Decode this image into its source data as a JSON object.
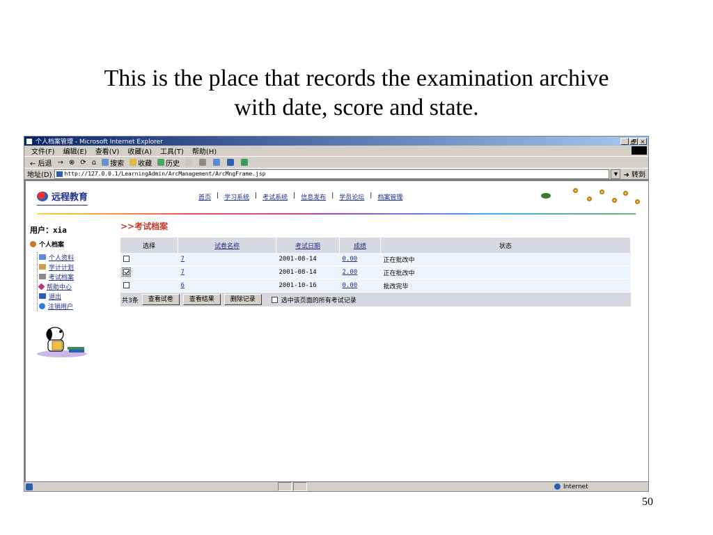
{
  "slide": {
    "title_line1": "This is the place that records the examination archive",
    "title_line2": "with date, score and state.",
    "page_number": "50"
  },
  "window": {
    "title": "个人档案管理 - Microsoft Internet Explorer",
    "controls": [
      "_",
      "🗗",
      "×"
    ]
  },
  "menu": [
    "文件(F)",
    "编辑(E)",
    "查看(V)",
    "收藏(A)",
    "工具(T)",
    "帮助(H)"
  ],
  "toolbar": [
    "← 后退",
    "→",
    "⊗",
    "⟳",
    "⌂",
    "搜索",
    "收藏",
    "历史"
  ],
  "address": {
    "label": "地址(D)",
    "url": "http://127.0.0.1/LearningAdmin/ArcManagement/ArcMngFrame.jsp",
    "go_label": "转到"
  },
  "header": {
    "site_name": "远程教育",
    "nav": [
      "首页",
      "学习系统",
      "考试系统",
      "信息发布",
      "学员论坛",
      "档案管理"
    ],
    "nav_separator": "|"
  },
  "sidebar": {
    "user_label": "用户：",
    "user_name": "xia",
    "root_label": "个人档案",
    "items": [
      {
        "label": "个人资料",
        "icon": "folder-icon",
        "color": "#5b8ad6"
      },
      {
        "label": "学计计划",
        "icon": "folder-open-icon",
        "color": "#c7a24a"
      },
      {
        "label": "考试档案",
        "icon": "mail-icon",
        "color": "#8a8a8a"
      },
      {
        "label": "帮助中心",
        "icon": "diamond-icon",
        "color": "#b03c7a"
      },
      {
        "label": "退出",
        "icon": "door-icon",
        "color": "#2a5fb0"
      },
      {
        "label": "注销用户",
        "icon": "globe-icon",
        "color": "#2a7fd6"
      }
    ]
  },
  "main": {
    "section_title": ">>考试档案",
    "columns": [
      "选择",
      "试卷名称",
      "考试日期",
      "成绩",
      "状态"
    ],
    "rows": [
      {
        "checked": false,
        "paper": "7",
        "date": "2001-08-14",
        "score": "0.00",
        "status": "正在批改中"
      },
      {
        "checked": true,
        "paper": "7",
        "date": "2001-08-14",
        "score": "2.00",
        "status": "正在批改中"
      },
      {
        "checked": false,
        "paper": "6",
        "date": "2001-10-16",
        "score": "0.00",
        "status": "批改完毕"
      }
    ],
    "total_label": "共3条",
    "buttons": [
      "查看试卷",
      "查看结果",
      "删除记录"
    ],
    "select_all_label": "选中该页面的所有考试记录"
  },
  "status": {
    "zone": "Internet"
  }
}
